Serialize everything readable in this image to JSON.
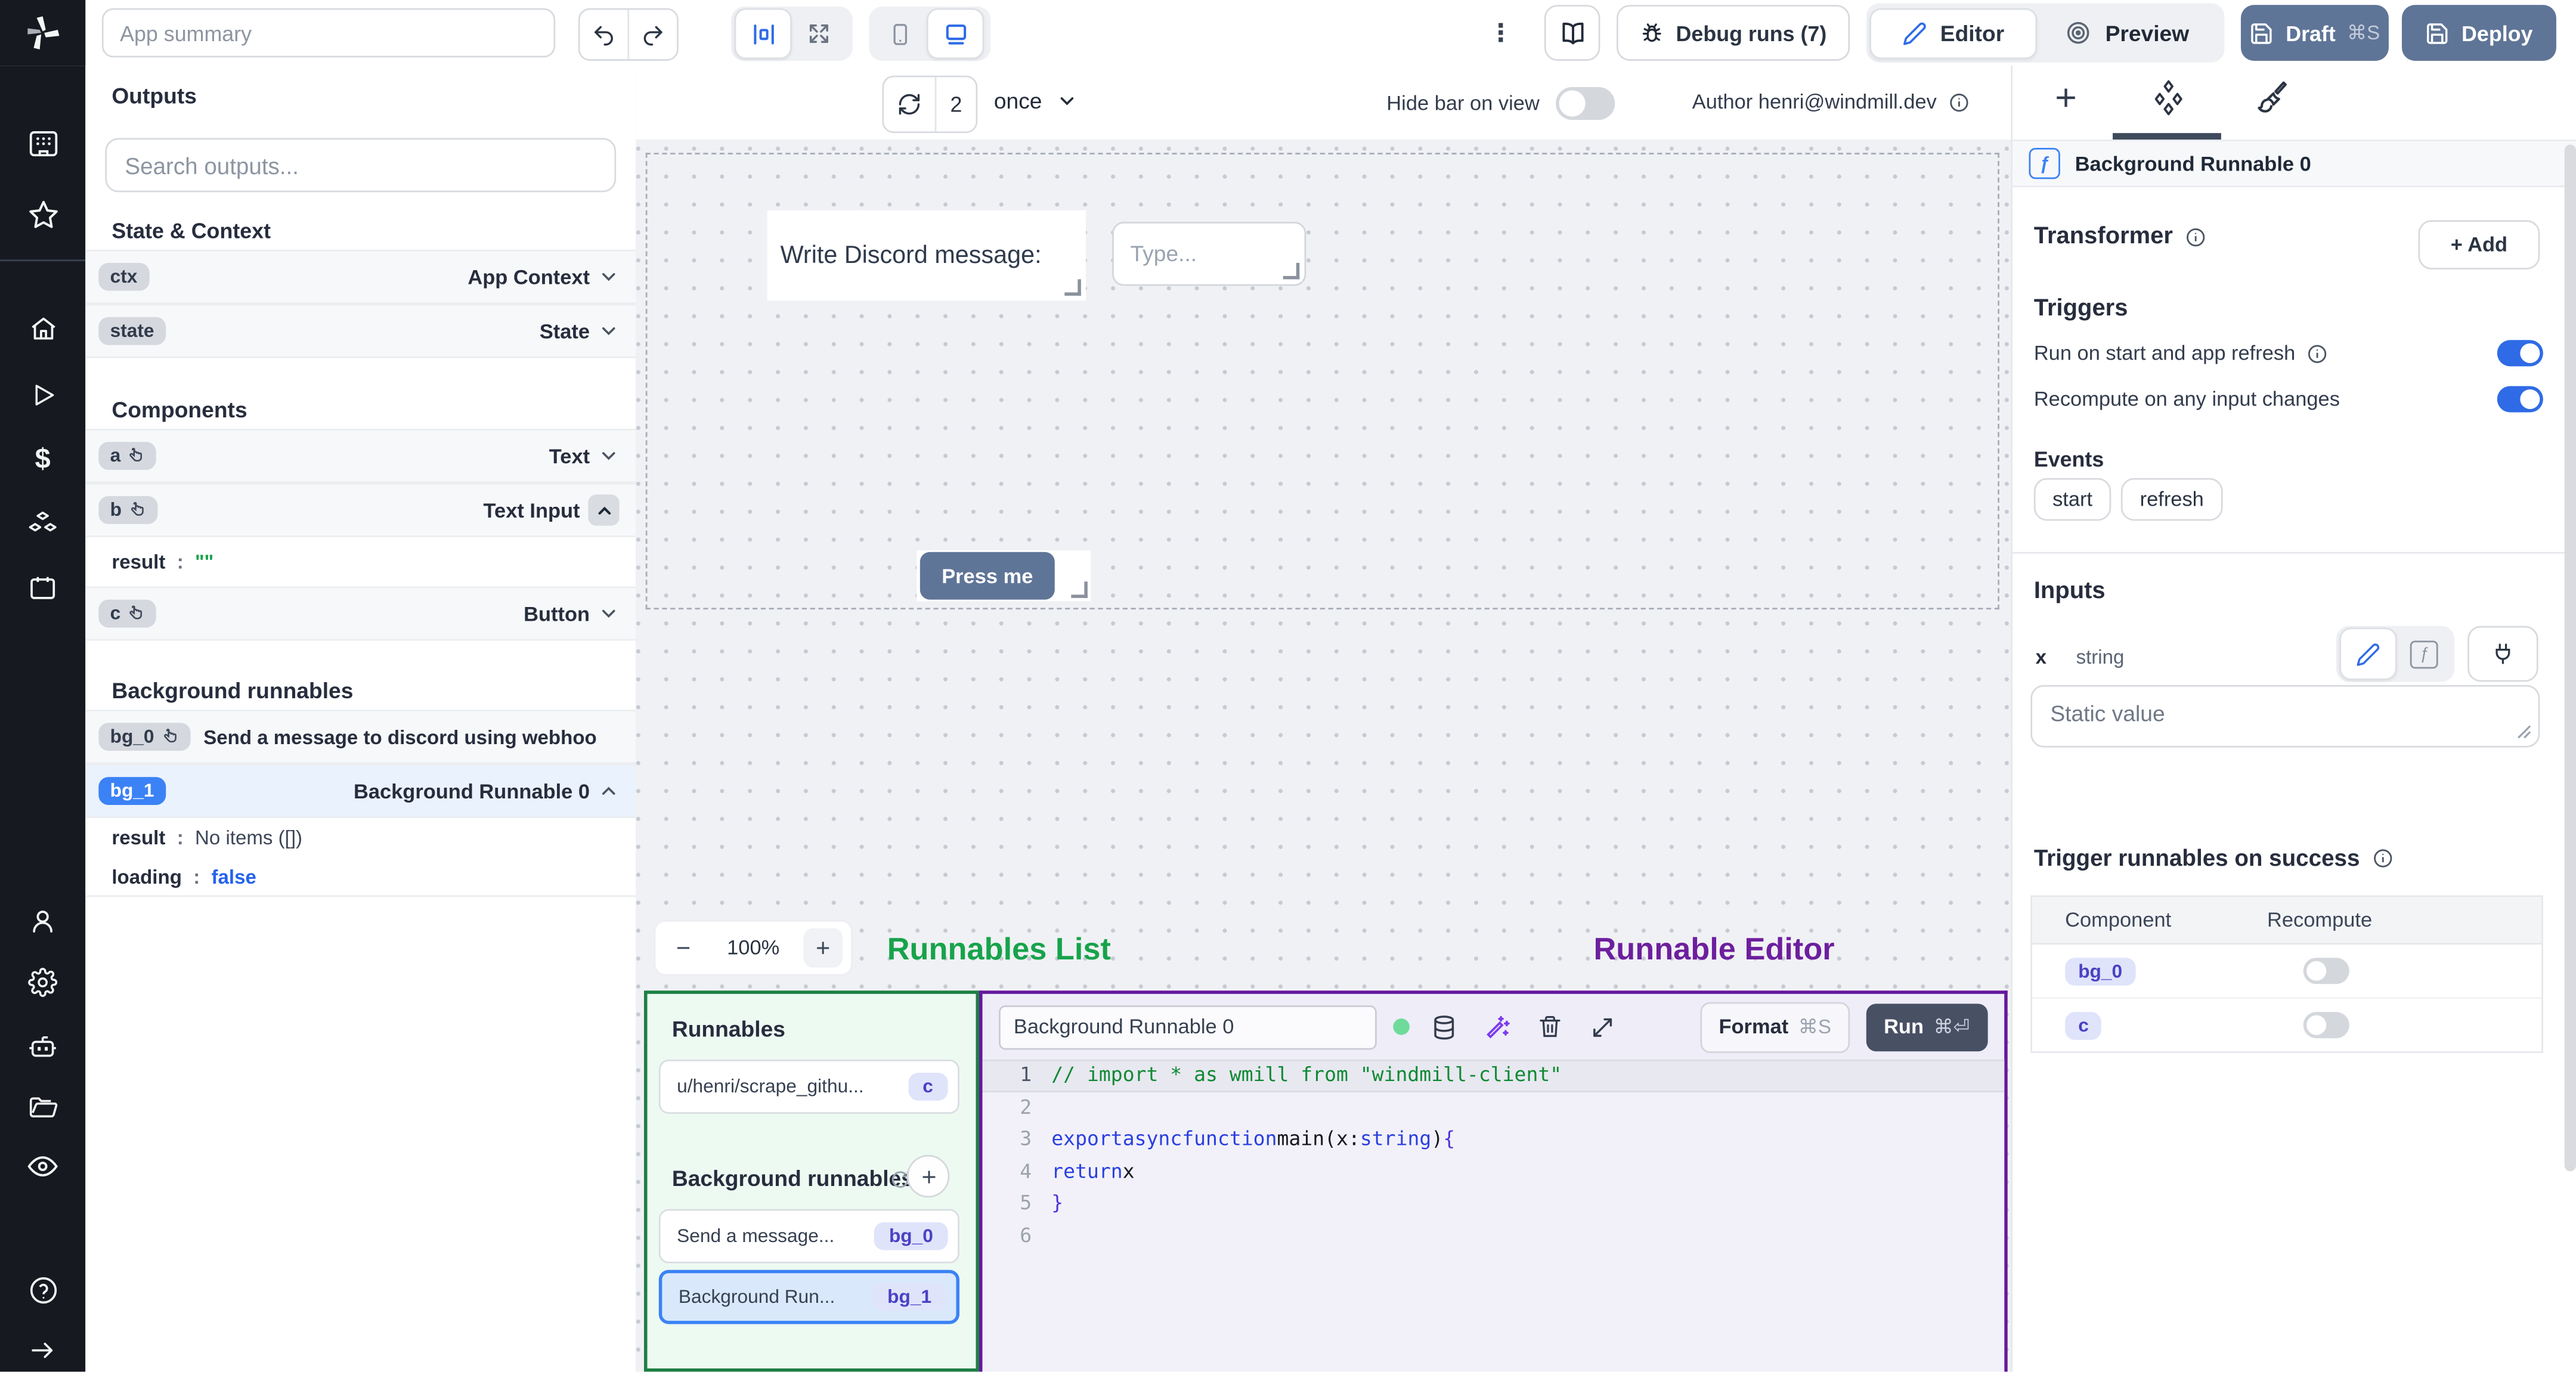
{
  "topbar": {
    "summary_placeholder": "App summary",
    "debug_runs_label": "Debug runs (7)",
    "editor_label": "Editor",
    "preview_label": "Preview",
    "draft_label": "Draft",
    "draft_kbd": "⌘S",
    "deploy_label": "Deploy"
  },
  "subbar": {
    "refresh_count": "2",
    "schedule_value": "once",
    "hide_bar_label": "Hide bar on view",
    "author_label": "Author henri@windmill.dev"
  },
  "outputs": {
    "title": "Outputs",
    "search_placeholder": "Search outputs...",
    "state_context_title": "State & Context",
    "ctx_badge": "ctx",
    "ctx_label": "App Context",
    "state_badge": "state",
    "state_label": "State",
    "components_title": "Components",
    "comp_a_badge": "a",
    "comp_a_label": "Text",
    "comp_b_badge": "b",
    "comp_b_label": "Text Input",
    "comp_b_result_key": "result",
    "comp_b_result_val": "\"\"",
    "comp_c_badge": "c",
    "comp_c_label": "Button",
    "bg_title": "Background runnables",
    "bg0_badge": "bg_0",
    "bg0_label": "Send a message to discord using webhoo",
    "bg1_badge": "bg_1",
    "bg1_label": "Background Runnable 0",
    "bg1_result_key": "result",
    "bg1_result_val": "No items ([])",
    "bg1_loading_key": "loading",
    "bg1_loading_val": "false"
  },
  "canvas": {
    "text_component": "Write Discord message:",
    "input_placeholder": "Type...",
    "button_label": "Press me",
    "zoom_minus": "−",
    "zoom_value": "100%",
    "zoom_plus": "+"
  },
  "annotations": {
    "runnables_list": "Runnables List",
    "runnable_editor": "Runnable Editor"
  },
  "runnables_panel": {
    "title": "Runnables",
    "item1_label": "u/henri/scrape_githu...",
    "item1_badge": "c",
    "bg_title": "Background runnables",
    "item2_label": "Send a message...",
    "item2_badge": "bg_0",
    "item3_label": "Background Run...",
    "item3_badge": "bg_1"
  },
  "editor": {
    "name_value": "Background Runnable 0",
    "format_label": "Format",
    "format_kbd": "⌘S",
    "run_label": "Run",
    "run_kbd": "⌘⏎",
    "code": {
      "language_hint": "typescript",
      "lines": [
        {
          "num": 1,
          "active": true,
          "tokens": [
            {
              "c": "cm",
              "t": "// import * as wmill from \"windmill-client\""
            }
          ]
        },
        {
          "num": 2,
          "tokens": []
        },
        {
          "num": 3,
          "tokens": [
            {
              "c": "kw",
              "t": "export"
            },
            {
              "c": "pl",
              "t": " "
            },
            {
              "c": "kw",
              "t": "async"
            },
            {
              "c": "pl",
              "t": " "
            },
            {
              "c": "kw",
              "t": "function"
            },
            {
              "c": "pl",
              "t": " main(x"
            },
            {
              "c": "pl",
              "t": ": "
            },
            {
              "c": "ty",
              "t": "string"
            },
            {
              "c": "pl",
              "t": ") "
            },
            {
              "c": "br",
              "t": "{"
            }
          ]
        },
        {
          "num": 4,
          "tokens": [
            {
              "c": "pl",
              "t": "  "
            },
            {
              "c": "kw",
              "t": "return"
            },
            {
              "c": "pl",
              "t": " x"
            }
          ]
        },
        {
          "num": 5,
          "tokens": [
            {
              "c": "br",
              "t": "}"
            }
          ]
        },
        {
          "num": 6,
          "tokens": []
        }
      ]
    }
  },
  "right_panel": {
    "header_title": "Background Runnable 0",
    "transformer_title": "Transformer",
    "add_label": "+ Add",
    "triggers_title": "Triggers",
    "run_on_start_label": "Run on start and app refresh",
    "run_on_start_on": true,
    "recompute_label": "Recompute on any input changes",
    "recompute_on": true,
    "events_title": "Events",
    "event_buttons": [
      "start",
      "refresh"
    ],
    "inputs_title": "Inputs",
    "input_name": "x",
    "input_type": "string",
    "static_placeholder": "Static value",
    "trigger_success_title": "Trigger runnables on success",
    "table": {
      "headers": [
        "Component",
        "Recompute"
      ],
      "rows": [
        {
          "component": "bg_0",
          "recompute": "off"
        },
        {
          "component": "c",
          "recompute": "off"
        }
      ]
    }
  },
  "icons": {
    "logo": "windmill-pinwheel",
    "undo": "undo-arrow",
    "redo": "redo-arrow",
    "align": "align-center",
    "fit": "expand-arrows",
    "mobile": "smartphone",
    "desktop": "monitor",
    "menu": "kebab",
    "docs": "open-book",
    "debug": "bug",
    "edit": "pencil",
    "preview": "eye",
    "save": "floppy-disk",
    "refresh": "circular-arrows",
    "db": "database",
    "ai": "magic-wand",
    "delete": "trash",
    "expand": "diagonal-arrows",
    "connect": "plug",
    "function": "f-square",
    "components": "diamond-cluster",
    "style": "paintbrush"
  },
  "colors": {
    "accent_blue": "#2f6be6",
    "badge_blue": "#3b82f6",
    "slate_button": "#5f7597",
    "run_button": "#485064",
    "green_annotation": "#17a34b",
    "purple_annotation": "#6d1f9e",
    "green_border": "#1d7f44",
    "purple_border": "#65189c",
    "comment_green": "#0e8a33",
    "keyword_blue": "#2a3fe0",
    "indigo_badge_bg": "#dfe4fb",
    "indigo_badge_text": "#4a41c4"
  }
}
